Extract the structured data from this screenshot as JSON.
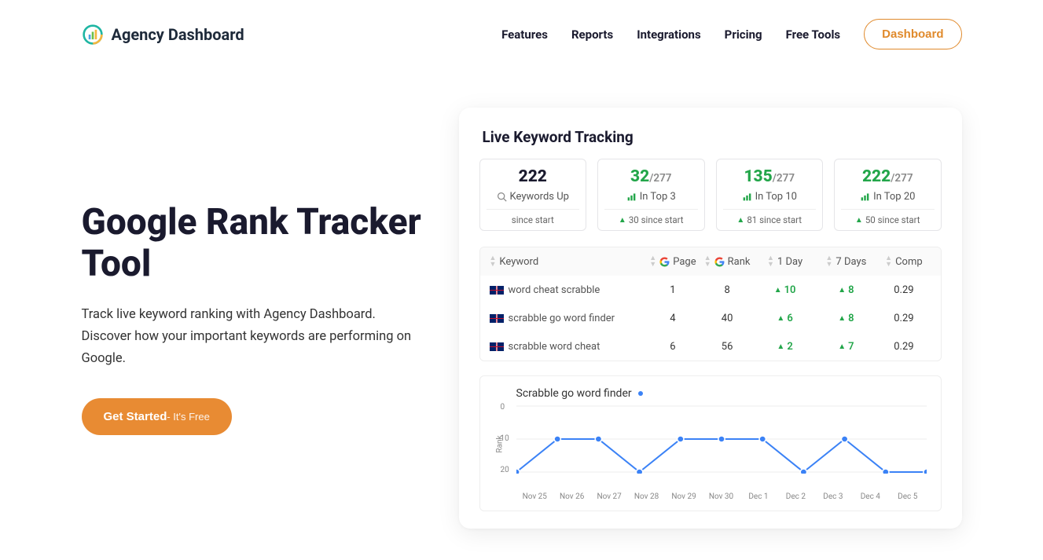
{
  "brand": {
    "name": "Agency Dashboard"
  },
  "nav": {
    "items": [
      "Features",
      "Reports",
      "Integrations",
      "Pricing",
      "Free Tools"
    ],
    "dashboard": "Dashboard"
  },
  "hero": {
    "title": "Google Rank Tracker Tool",
    "desc": "Track live keyword ranking with Agency Dashboard. Discover how your important keywords are performing on Google.",
    "cta_main": "Get Started",
    "cta_sub": "- It's Free"
  },
  "dashboard": {
    "title": "Live Keyword Tracking",
    "stats": [
      {
        "value": "222",
        "total": "",
        "label": "Keywords Up",
        "footer": "since start",
        "icon": "magnifier",
        "green": false,
        "foot_up": false
      },
      {
        "value": "32",
        "total": "/277",
        "label": "In Top 3",
        "footer": "30 since start",
        "icon": "bars",
        "green": true,
        "foot_up": true
      },
      {
        "value": "135",
        "total": "/277",
        "label": "In Top 10",
        "footer": "81 since start",
        "icon": "bars",
        "green": true,
        "foot_up": true
      },
      {
        "value": "222",
        "total": "/277",
        "label": "In Top 20",
        "footer": "50 since start",
        "icon": "bars",
        "green": true,
        "foot_up": true
      }
    ],
    "table": {
      "headers": [
        "Keyword",
        "Page",
        "Rank",
        "1 Day",
        "7 Days",
        "Comp"
      ],
      "g_cols": [
        1,
        2
      ],
      "rows": [
        {
          "flag": "au",
          "keyword": "word cheat scrabble",
          "page": "1",
          "rank": "8",
          "d1": "10",
          "d7": "8",
          "comp": "0.29"
        },
        {
          "flag": "au",
          "keyword": "scrabble go word finder",
          "page": "4",
          "rank": "40",
          "d1": "6",
          "d7": "8",
          "comp": "0.29"
        },
        {
          "flag": "au",
          "keyword": "scrabble word cheat",
          "page": "6",
          "rank": "56",
          "d1": "2",
          "d7": "7",
          "comp": "0.29"
        }
      ]
    },
    "chart_title": "Scrabble go word finder",
    "chart_ylabel": "Rank"
  },
  "chart_data": {
    "type": "line",
    "title": "Scrabble go word finder",
    "xlabel": "",
    "ylabel": "Rank",
    "ylim": [
      0,
      20
    ],
    "yticks": [
      0,
      10,
      20
    ],
    "categories": [
      "Nov 25",
      "Nov 26",
      "Nov 27",
      "Nov 28",
      "Nov 29",
      "Nov 30",
      "Dec 1",
      "Dec 2",
      "Dec 3",
      "Dec 4",
      "Dec 5"
    ],
    "values": [
      20,
      10,
      10,
      20,
      10,
      10,
      10,
      20,
      10,
      20,
      20
    ]
  }
}
